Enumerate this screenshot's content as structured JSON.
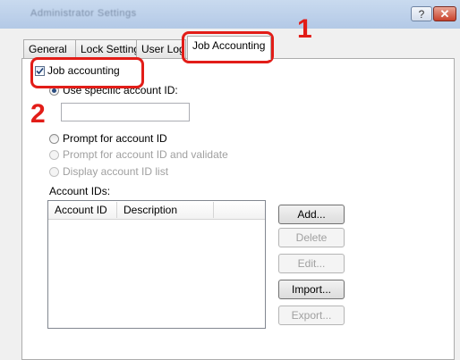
{
  "window": {
    "title": "Administrator Settings",
    "help_label": "?",
    "close_label": "✕"
  },
  "tabs": [
    {
      "label": "General"
    },
    {
      "label": "Lock Settings"
    },
    {
      "label": "User Log"
    },
    {
      "label": "Job Accounting"
    }
  ],
  "job_accounting": {
    "checkbox_label": "Job accounting",
    "checked": true,
    "options": [
      {
        "label": "Use specific account ID:",
        "selected": true,
        "enabled": true
      },
      {
        "label": "Prompt for account ID",
        "selected": false,
        "enabled": true
      },
      {
        "label": "Prompt for account ID and validate",
        "selected": false,
        "enabled": false
      },
      {
        "label": "Display account ID list",
        "selected": false,
        "enabled": false
      }
    ],
    "account_id_value": "",
    "account_ids_label": "Account IDs:",
    "columns": [
      "Account ID",
      "Description"
    ],
    "rows": []
  },
  "buttons": {
    "add": "Add...",
    "delete": "Delete",
    "edit": "Edit...",
    "import": "Import...",
    "export": "Export..."
  },
  "annotations": {
    "step1": "1",
    "step2": "2",
    "highlight_color": "#e21d18"
  }
}
